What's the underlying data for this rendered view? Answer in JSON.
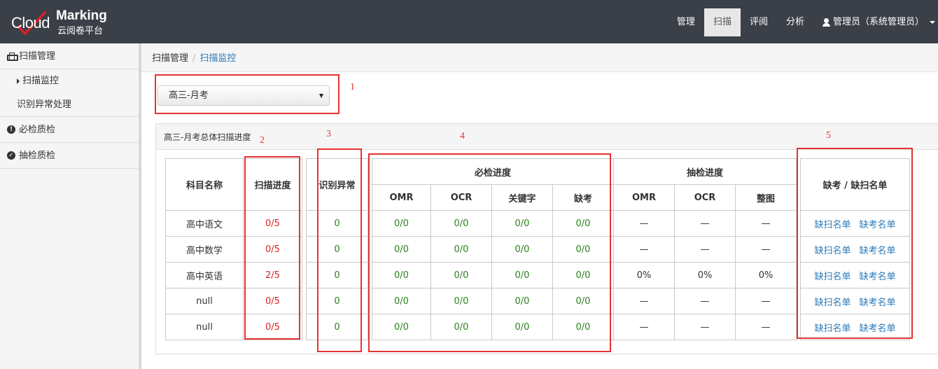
{
  "navbar": {
    "logo_cloud": "Cloud",
    "logo_marking": "Marking",
    "logo_subtitle": "云阅卷平台",
    "items": [
      "管理",
      "扫描",
      "评阅",
      "分析"
    ],
    "active_index": 1,
    "user_label": "管理员（系统管理员）"
  },
  "sidebar": {
    "scan_management": "扫描管理",
    "scan_monitor": "扫描监控",
    "exception_handling": "识别异常处理",
    "required_check": "必检质检",
    "sample_check": "抽检质检"
  },
  "breadcrumb": {
    "root": "扫描管理",
    "current": "扫描监控"
  },
  "exam_select": {
    "value": "高三-月考"
  },
  "panel": {
    "title": "高三-月考总体扫描进度"
  },
  "table": {
    "headers": {
      "subject": "科目名称",
      "scan_progress": "扫描进度",
      "recognition_exception": "识别异常",
      "required_progress": "必检进度",
      "sample_progress": "抽检进度",
      "missing_list": "缺考 / 缺扫名单",
      "omr": "OMR",
      "ocr": "OCR",
      "keyword": "关键字",
      "absent": "缺考",
      "whole_image": "整图"
    },
    "rows": [
      {
        "subject": "高中语文",
        "scan": "0/5",
        "exception": "0",
        "req_omr": "0/0",
        "req_ocr": "0/0",
        "req_kw": "0/0",
        "req_absent": "0/0",
        "smp_omr": "—",
        "smp_ocr": "—",
        "smp_whole": "—"
      },
      {
        "subject": "高中数学",
        "scan": "0/5",
        "exception": "0",
        "req_omr": "0/0",
        "req_ocr": "0/0",
        "req_kw": "0/0",
        "req_absent": "0/0",
        "smp_omr": "—",
        "smp_ocr": "—",
        "smp_whole": "—"
      },
      {
        "subject": "高中英语",
        "scan": "2/5",
        "exception": "0",
        "req_omr": "0/0",
        "req_ocr": "0/0",
        "req_kw": "0/0",
        "req_absent": "0/0",
        "smp_omr": "0%",
        "smp_ocr": "0%",
        "smp_whole": "0%"
      },
      {
        "subject": "null",
        "scan": "0/5",
        "exception": "0",
        "req_omr": "0/0",
        "req_ocr": "0/0",
        "req_kw": "0/0",
        "req_absent": "0/0",
        "smp_omr": "—",
        "smp_ocr": "—",
        "smp_whole": "—"
      },
      {
        "subject": "null",
        "scan": "0/5",
        "exception": "0",
        "req_omr": "0/0",
        "req_ocr": "0/0",
        "req_kw": "0/0",
        "req_absent": "0/0",
        "smp_omr": "—",
        "smp_ocr": "—",
        "smp_whole": "—"
      }
    ],
    "link_missing_scan": "缺扫名单",
    "link_absent": "缺考名单"
  },
  "annotations": [
    "1",
    "2",
    "3",
    "4",
    "5"
  ],
  "colors": {
    "navbar": "#3b3f47",
    "annotation": "#e53333",
    "link": "#2a7ab9",
    "scan_value": "#e02020",
    "ok_value": "#2c7f1e"
  }
}
